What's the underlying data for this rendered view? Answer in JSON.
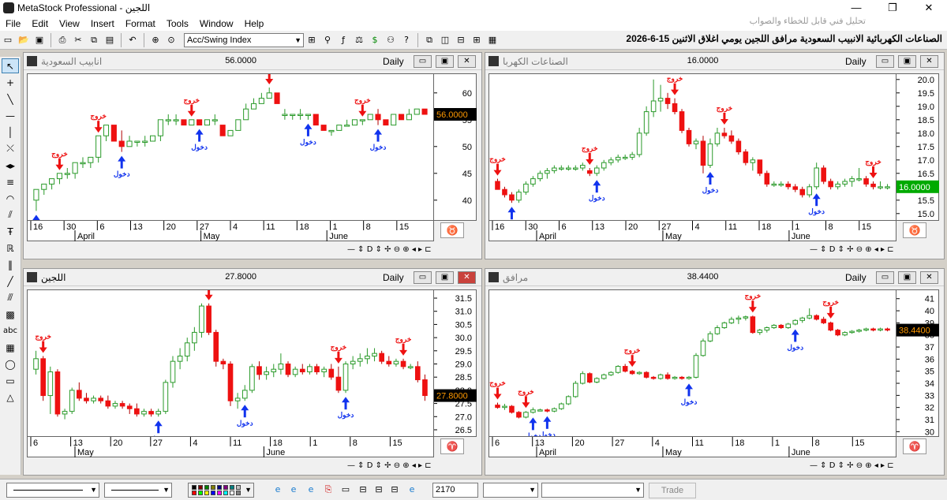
{
  "app": {
    "title": "MetaStock Professional - اللجين",
    "hint": "تحليل فني قابل للخطاء والصواب",
    "window_buttons": [
      "—",
      "❐",
      "✕"
    ]
  },
  "menu": [
    "File",
    "Edit",
    "View",
    "Insert",
    "Format",
    "Tools",
    "Window",
    "Help"
  ],
  "toolbar": {
    "indicator": "Acc/Swing Index",
    "page_title": "الصناعات الكهربائية الانبيب السعودية مرافق اللجين يومي اغلاق الاثنين 15-6-2026"
  },
  "labels": {
    "exit": "خروج",
    "entry": "دخول"
  },
  "colors": {
    "up": "#33dd33",
    "down": "#ee1111",
    "exit_arrow": "#ee1111",
    "entry_arrow": "#1133ee",
    "price_tag": "#000000",
    "price_tag_text": "#ff9900",
    "last_price_tag_green": "#00aa00"
  },
  "charts": [
    {
      "id": "pipes",
      "name": "انابيب السعودية",
      "price": "56.0000",
      "period": "Daily",
      "active": false,
      "last_price_tag": "56.0000",
      "tag_color": "black",
      "y_ticks": [
        "60",
        "55",
        "50",
        "45",
        "40"
      ],
      "y_ticks_vals": [
        60,
        55,
        50,
        45,
        40
      ],
      "x_days": [
        "16",
        "30",
        "6",
        "13",
        "20",
        "27",
        "4",
        "11",
        "18",
        "1",
        "8",
        "15"
      ],
      "x_months": [
        "April",
        "May",
        "June"
      ],
      "footer": "— ⇕ D ⇕ ✢ ⊖ ⊕ ◂ ▸ ⊏"
    },
    {
      "id": "electric",
      "name": "الصناعات الكهربا",
      "price": "16.0000",
      "period": "Daily",
      "active": false,
      "last_price_tag": "16.0000",
      "tag_color": "green",
      "y_ticks": [
        "20.0",
        "19.5",
        "19.0",
        "18.5",
        "18.0",
        "17.5",
        "17.0",
        "16.5",
        "16.0",
        "15.5",
        "15.0"
      ],
      "y_ticks_vals": [
        20.0,
        19.5,
        19.0,
        18.5,
        18.0,
        17.5,
        17.0,
        16.5,
        16.0,
        15.5,
        15.0
      ],
      "x_days": [
        "16",
        "30",
        "6",
        "13",
        "20",
        "27",
        "4",
        "11",
        "18",
        "1",
        "8",
        "15"
      ],
      "x_months": [
        "April",
        "May",
        "June"
      ],
      "footer": "— ⇕ D ⇕ ✢ ⊖ ⊕ ◂ ▸ ⊏"
    },
    {
      "id": "lujain",
      "name": "اللجين",
      "price": "27.8000",
      "period": "Daily",
      "active": true,
      "last_price_tag": "27.8000",
      "tag_color": "black",
      "y_ticks": [
        "31.5",
        "31.0",
        "30.5",
        "30.0",
        "29.5",
        "29.0",
        "28.5",
        "28.0",
        "27.5",
        "27.0",
        "26.5"
      ],
      "y_ticks_vals": [
        31.5,
        31.0,
        30.5,
        30.0,
        29.5,
        29.0,
        28.5,
        28.0,
        27.5,
        27.0,
        26.5
      ],
      "x_days": [
        "6",
        "13",
        "20",
        "27",
        "4",
        "11",
        "18",
        "1",
        "8",
        "15"
      ],
      "x_months": [
        "May",
        "June"
      ],
      "footer": "— ⇕ D ⇕ ✢ ⊖ ⊕ ◂ ▸ ⊏"
    },
    {
      "id": "marafiq",
      "name": "مرافق",
      "price": "38.4400",
      "period": "Daily",
      "active": false,
      "last_price_tag": "38.4400",
      "tag_color": "black",
      "y_ticks": [
        "41",
        "40",
        "39",
        "38",
        "37",
        "36",
        "35",
        "34",
        "33",
        "32",
        "31",
        "30"
      ],
      "y_ticks_vals": [
        41,
        40,
        39,
        38,
        37,
        36,
        35,
        34,
        33,
        32,
        31,
        30
      ],
      "x_days": [
        "6",
        "13",
        "20",
        "27",
        "4",
        "11",
        "18",
        "1",
        "8",
        "15"
      ],
      "x_months": [
        "April",
        "May",
        "June"
      ],
      "footer": "— ⇕ D ⇕ ✢ ⊖ ⊕ ◂ ▸ ⊏"
    }
  ],
  "status": {
    "price_field": "2170",
    "trade": "Trade"
  }
}
